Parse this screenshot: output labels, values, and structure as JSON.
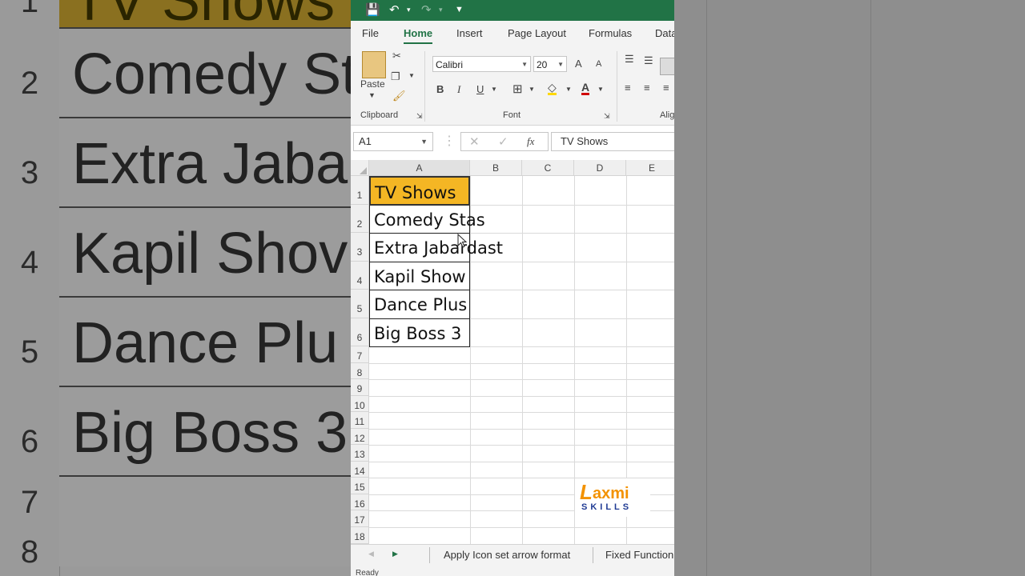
{
  "background": {
    "rows": [
      {
        "num": "1",
        "text": "TV Shows"
      },
      {
        "num": "2",
        "text": "Comedy St"
      },
      {
        "num": "3",
        "text": "Extra Jaba"
      },
      {
        "num": "4",
        "text": "Kapil Shov"
      },
      {
        "num": "5",
        "text": "Dance Plu"
      },
      {
        "num": "6",
        "text": "Big Boss 3"
      },
      {
        "num": "7",
        "text": ""
      },
      {
        "num": "8",
        "text": ""
      }
    ]
  },
  "ribbon": {
    "tabs": [
      "File",
      "Home",
      "Insert",
      "Page Layout",
      "Formulas",
      "Data"
    ],
    "active_tab": "Home",
    "paste_label": "Paste",
    "clipboard_label": "Clipboard",
    "font_label": "Font",
    "alignment_label": "Alig",
    "font_name": "Calibri",
    "font_size": "20",
    "bold": "B",
    "italic": "I",
    "underline": "U",
    "grow": "A",
    "shrink": "A"
  },
  "formula_bar": {
    "name_box": "A1",
    "fx": "fx",
    "content": "TV Shows"
  },
  "grid": {
    "columns": [
      "A",
      "B",
      "C",
      "D",
      "E"
    ],
    "rows": [
      "1",
      "2",
      "3",
      "4",
      "5",
      "6",
      "7",
      "8",
      "9",
      "10",
      "11",
      "12",
      "13",
      "14",
      "15",
      "16",
      "17",
      "18"
    ],
    "cells": [
      "TV Shows",
      "Comedy Stas",
      "Extra Jabardast",
      "Kapil Show",
      "Dance Plus",
      "Big Boss 3"
    ]
  },
  "sheets": {
    "tab1": "Apply Icon set arrow format",
    "tab2": "Fixed Function"
  },
  "status": "Ready",
  "logo": {
    "name": "axmi",
    "sub": "SKILLS",
    "letter": "L"
  },
  "colors": {
    "excel_green": "#217346",
    "header_fill": "#f4b624",
    "logo_orange": "#f39200",
    "logo_blue": "#1f3a93"
  }
}
